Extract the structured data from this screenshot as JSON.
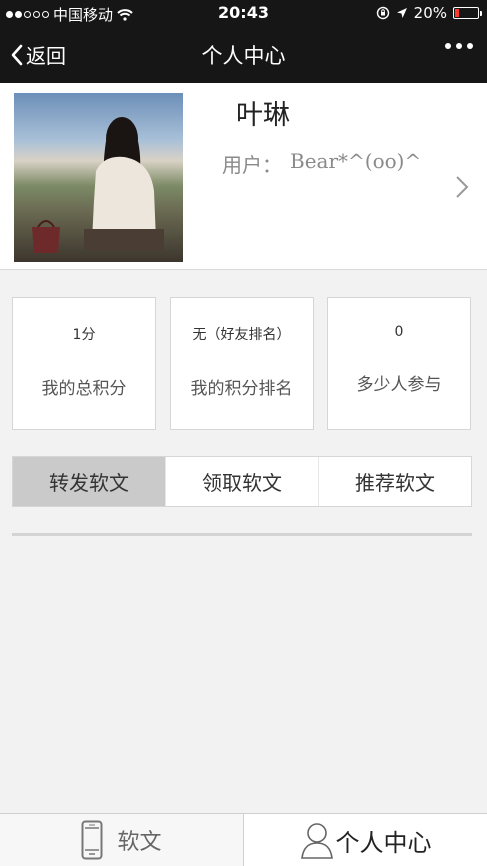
{
  "status_bar": {
    "carrier": "中国移动",
    "time": "20:43",
    "battery": "20%",
    "battery_level": 0.2,
    "battery_color": "#ff3b30"
  },
  "nav": {
    "back_label": "返回",
    "title": "个人中心",
    "more_icon": "ellipsis-icon"
  },
  "profile": {
    "name": "叶琳",
    "user_label": "用户：",
    "user_value": "Bear*^(oo)^"
  },
  "stats": [
    {
      "value": "1分",
      "label": "我的总积分"
    },
    {
      "value": "无（好友排名）",
      "label": "我的积分排名"
    },
    {
      "value": "0",
      "label": "多少人参与"
    }
  ],
  "tabs": [
    {
      "label": "转发软文",
      "active": true
    },
    {
      "label": "领取软文",
      "active": false
    },
    {
      "label": "推荐软文",
      "active": false
    }
  ],
  "bottom_nav": [
    {
      "label": "软文",
      "icon": "phone-icon",
      "active": false
    },
    {
      "label": "个人中心",
      "icon": "user-icon",
      "active": true
    }
  ],
  "colors": {
    "bar_bg": "#161616",
    "active_tab": "#cacaca"
  }
}
